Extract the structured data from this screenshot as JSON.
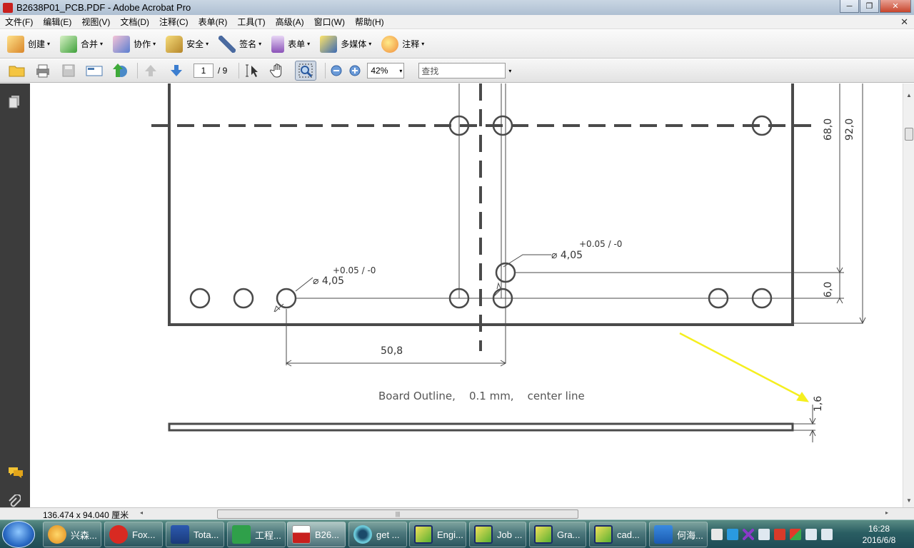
{
  "window": {
    "title": "B2638P01_PCB.PDF - Adobe Acrobat Pro",
    "minimize": "─",
    "maximize": "❐",
    "close": "✕"
  },
  "menu": {
    "items": [
      "文件(F)",
      "编辑(E)",
      "视图(V)",
      "文档(D)",
      "注释(C)",
      "表单(R)",
      "工具(T)",
      "高级(A)",
      "窗口(W)",
      "帮助(H)"
    ],
    "close_glyph": "✕"
  },
  "toolbar": {
    "create": "创建",
    "combine": "合并",
    "collaborate": "协作",
    "secure": "安全",
    "sign": "签名",
    "forms": "表单",
    "multimedia": "多媒体",
    "comment": "注释",
    "caret": "▾"
  },
  "nav": {
    "page_current": "1",
    "page_total": "/ 9",
    "zoom": "42%",
    "find_placeholder": "查找",
    "caret": "▾"
  },
  "drawing": {
    "dim_68": "68,0",
    "dim_92": "92,0",
    "dim_6": "6,0",
    "hole_tol_right": "+0.05 / -0",
    "hole_dia_right": "⌀ 4,05",
    "hole_tol_left": "+0.05 / -0",
    "hole_dia_left": "⌀ 4,05",
    "dim_50_8": "50,8",
    "note": "Board Outline,    0.1 mm,    center line",
    "dim_1_6": "1,6"
  },
  "status": {
    "page_size": "136.474 x 94.040 厘米"
  },
  "taskbar": {
    "tasks": [
      "兴森...",
      "Fox...",
      "Tota...",
      "工程...",
      "B26...",
      "get ...",
      "Engi...",
      "Job ...",
      "Gra...",
      "cad...",
      "何海..."
    ],
    "time": "16:28",
    "date": "2016/6/8"
  }
}
